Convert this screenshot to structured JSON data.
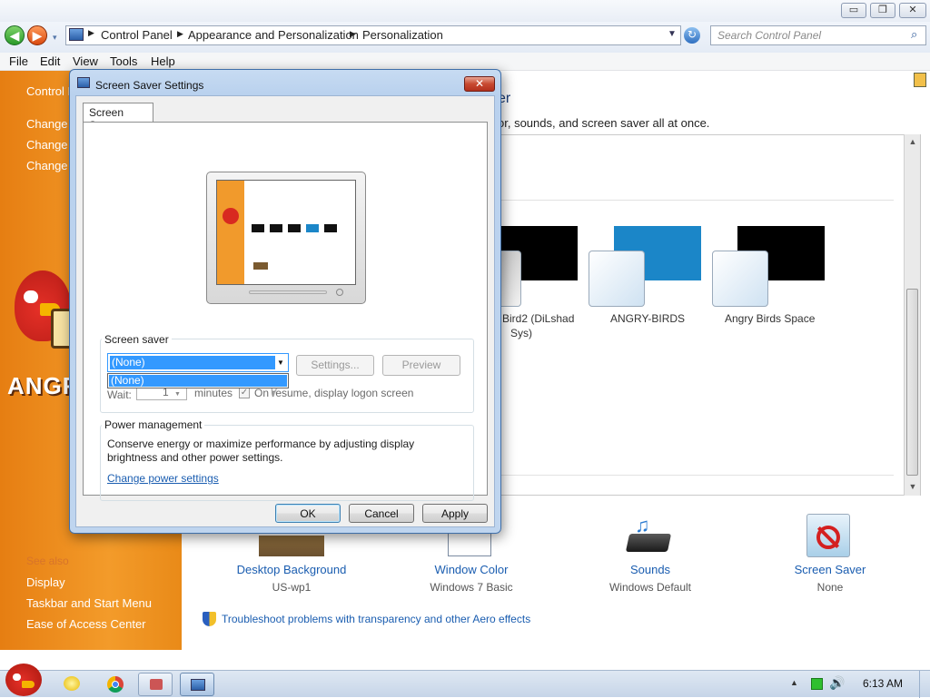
{
  "window": {
    "caption_minimize": "▭",
    "caption_restore": "❐",
    "caption_close": "✕"
  },
  "address": {
    "crumbs": [
      "Control Panel",
      "Appearance and Personalization",
      "Personalization"
    ],
    "search_placeholder": "Search Control Panel"
  },
  "menu": [
    "File",
    "Edit",
    "View",
    "Tools",
    "Help"
  ],
  "left_pane": {
    "home": "Control P",
    "links": [
      "Change d",
      "Change m",
      "Change y"
    ],
    "see_also_label": "See also",
    "see_also": [
      "Display",
      "Taskbar and Start Menu",
      "Ease of Access Center"
    ]
  },
  "content": {
    "heading_fragment": "er",
    "subtitle_fragment": "or, sounds, and screen saver all at once.",
    "themes": [
      {
        "name": "Bird2 (DiLshad",
        "sub": "Sys)"
      },
      {
        "name": "ANGRY-BIRDS",
        "sub": ""
      },
      {
        "name": "Angry Birds Space",
        "sub": ""
      }
    ],
    "tiles": [
      {
        "title": "Desktop Background",
        "sub": "US-wp1"
      },
      {
        "title": "Window Color",
        "sub": "Windows 7 Basic"
      },
      {
        "title": "Sounds",
        "sub": "Windows Default"
      },
      {
        "title": "Screen Saver",
        "sub": "None"
      }
    ],
    "troubleshoot": "Troubleshoot problems with transparency and other Aero effects"
  },
  "dialog": {
    "title": "Screen Saver Settings",
    "tab": "Screen Saver",
    "screensaver_group": "Screen saver",
    "selected": "(None)",
    "dropdown_option": "(None)",
    "settings_btn": "Settings...",
    "preview_btn": "Preview",
    "wait_label": "Wait:",
    "wait_value": "1",
    "minutes_label": "minutes",
    "resume_label": "On resume, display logon screen",
    "power_group": "Power management",
    "power_text_1": "Conserve energy or maximize performance by adjusting display",
    "power_text_2": "brightness and other power settings.",
    "power_link": "Change power settings",
    "ok": "OK",
    "cancel": "Cancel",
    "apply": "Apply"
  },
  "taskbar": {
    "clock": "6:13 AM"
  },
  "colors": {
    "orange_pane": "#f39b2a",
    "link_blue": "#1a5db0",
    "selection_blue": "#3399ff"
  }
}
